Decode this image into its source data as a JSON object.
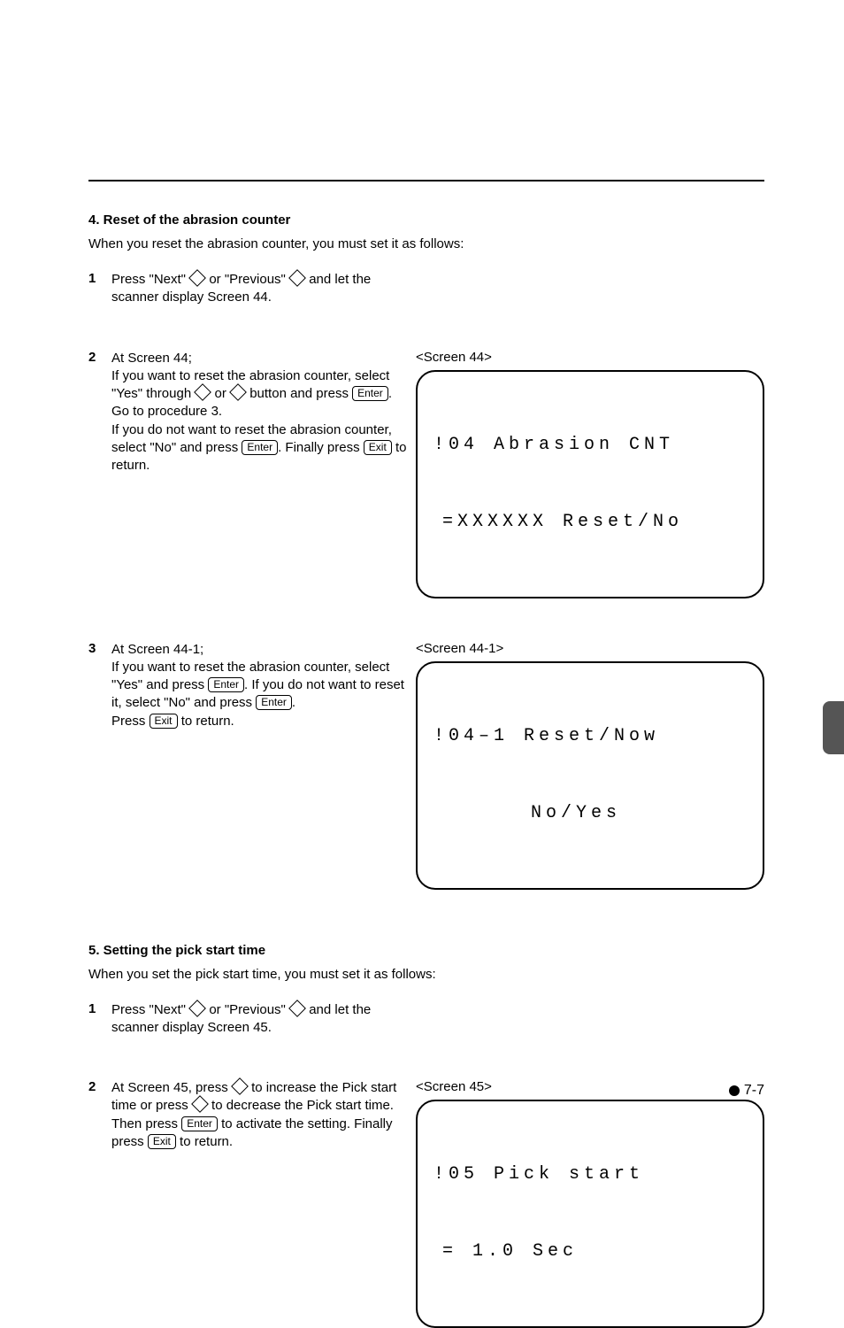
{
  "section4": {
    "title": "4. Reset of the abrasion counter",
    "intro": "When you reset the abrasion counter, you must set it as follows:",
    "steps": {
      "s1": {
        "num": "1",
        "t1": "Press \"Next\" ",
        "t2": " or \"Previous\" ",
        "t3": " and let the scanner display Screen 44."
      },
      "s2": {
        "num": "2",
        "t1": "At Screen 44;",
        "t2": "If you want to reset the abrasion counter, select \"Yes\" through ",
        "t3": " or ",
        "t4": " button and press ",
        "enter1": "Enter",
        "t5": ". Go to procedure 3.",
        "t6": "If you do not want to reset the abrasion counter, select \"No\" and press ",
        "enter2": "Enter",
        "t7": ". Finally press ",
        "exit": "Exit",
        "t8": " to return."
      },
      "s3": {
        "num": "3",
        "t1": "At Screen 44-1;",
        "t2": "If you want to reset the abrasion counter, select \"Yes\" and press ",
        "enter1": "Enter",
        "t3": ". If you do not want to reset it, select \"No\" and press ",
        "enter2": "Enter",
        "t4": ".",
        "t5": "Press ",
        "exit": "Exit",
        "t6": " to return."
      }
    },
    "screen44": {
      "caption": "<Screen 44>",
      "line1": "!04 Abrasion CNT",
      "line2": "=XXXXXX Reset/No"
    },
    "screen44_1": {
      "caption": "<Screen 44-1>",
      "line1": "!04–1 Reset/Now",
      "line2": "No/Yes"
    }
  },
  "section5": {
    "title": "5. Setting the pick start time",
    "intro": "When you set the pick start time, you must set it as follows:",
    "steps": {
      "s1": {
        "num": "1",
        "t1": "Press \"Next\" ",
        "t2": " or \"Previous\" ",
        "t3": " and let the scanner display Screen 45."
      },
      "s2": {
        "num": "2",
        "t1": "At Screen 45, press ",
        "t2": " to increase the Pick start time or press ",
        "t3": " to decrease the Pick start time. Then press ",
        "enter": "Enter",
        "t4": " to activate the setting. Finally press ",
        "exit": "Exit",
        "t5": " to return."
      }
    },
    "screen45": {
      "caption": "<Screen 45>",
      "line1": "!05 Pick start",
      "line2": "= 1.0 Sec"
    }
  },
  "footer": {
    "page": "7-7"
  }
}
